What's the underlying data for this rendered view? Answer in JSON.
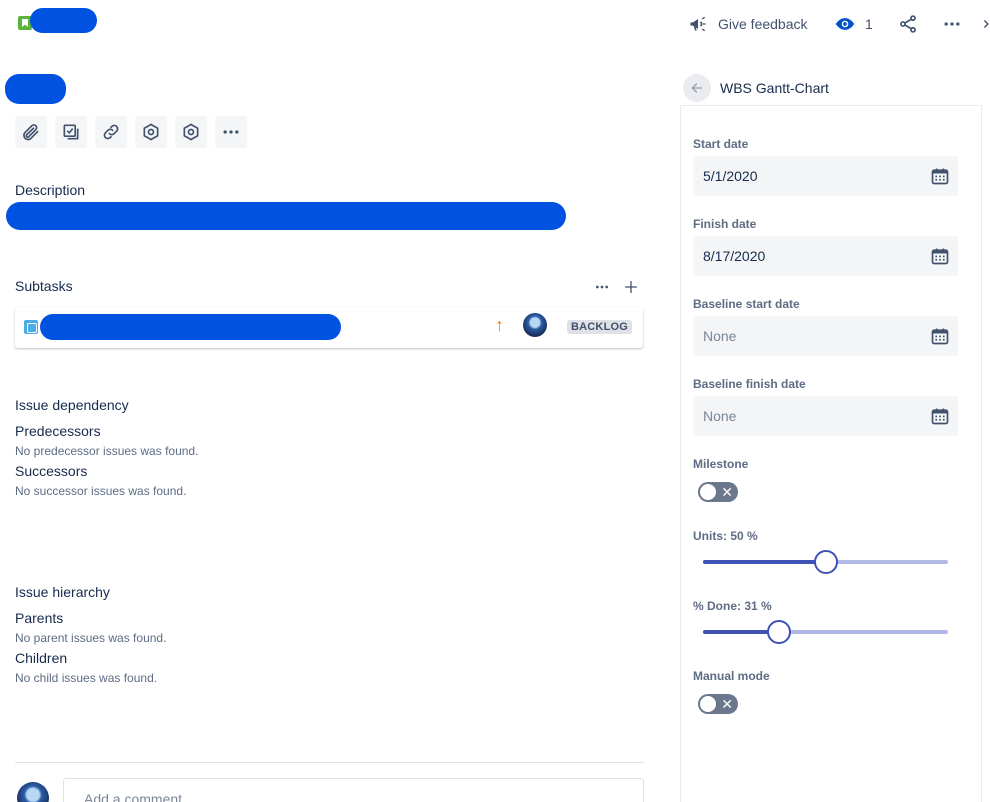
{
  "topbar": {
    "feedback_label": "Give feedback",
    "watch_count": "1"
  },
  "toolbar": {
    "icons": [
      "paperclip-icon",
      "checklist-icon",
      "link-icon",
      "hexagon-icon",
      "hexagon-icon",
      "more-icon"
    ]
  },
  "description": {
    "heading": "Description"
  },
  "subtasks": {
    "heading": "Subtasks",
    "items": [
      {
        "status": "BACKLOG"
      }
    ]
  },
  "dependency": {
    "heading": "Issue dependency",
    "predecessors_label": "Predecessors",
    "predecessors_empty": "No predecessor issues was found.",
    "successors_label": "Successors",
    "successors_empty": "No successor issues was found."
  },
  "hierarchy": {
    "heading": "Issue hierarchy",
    "parents_label": "Parents",
    "parents_empty": "No parent issues was found.",
    "children_label": "Children",
    "children_empty": "No child issues was found."
  },
  "comment": {
    "placeholder": "Add a comment..."
  },
  "panel": {
    "title": "WBS Gantt-Chart",
    "start_date_label": "Start date",
    "start_date": "5/1/2020",
    "finish_date_label": "Finish date",
    "finish_date": "8/17/2020",
    "baseline_start_label": "Baseline start date",
    "baseline_start": "None",
    "baseline_finish_label": "Baseline finish date",
    "baseline_finish": "None",
    "milestone_label": "Milestone",
    "milestone_on": false,
    "units_label": "Units: 50 %",
    "units_value": 50,
    "done_label": "% Done: 31 %",
    "done_value": 31,
    "manual_mode_label": "Manual mode",
    "manual_mode_on": false
  },
  "colors": {
    "accent": "#3f51b5",
    "redaction": "#0052e0",
    "priority": "#ff7a00"
  }
}
